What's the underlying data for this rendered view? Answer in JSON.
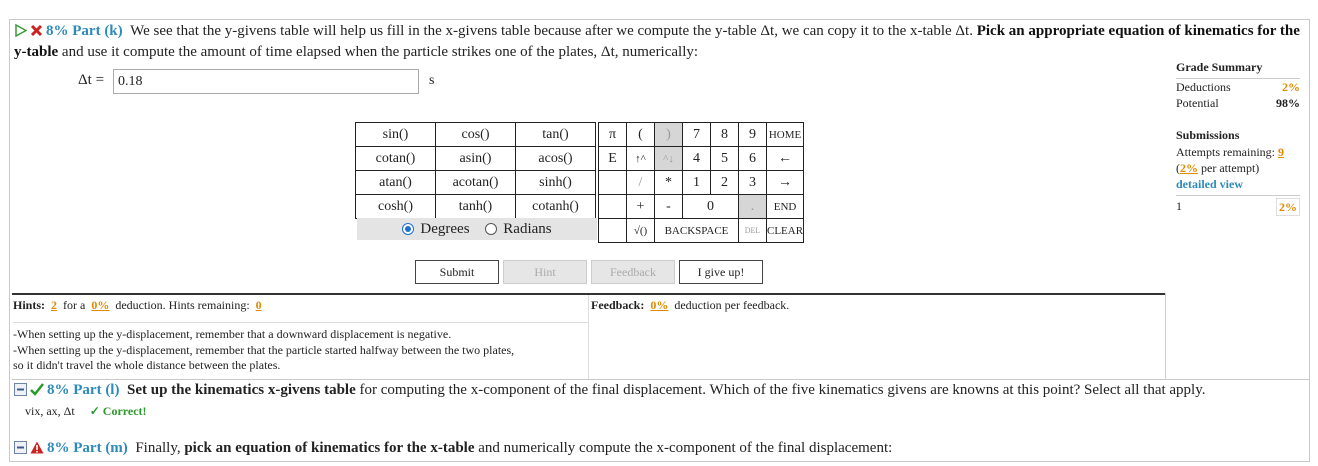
{
  "part_k": {
    "percent": "8% Part (k)",
    "text_1": "We see that the y-givens table will help us fill in the x-givens table because after we compute the y-table Δt, we can copy it to the x-table Δt.",
    "bold_1": "Pick an appropriate equation of kinematics for the y-table",
    "text_2": "and use it compute the amount of time elapsed when the particle strikes one of the plates, Δt, numerically:",
    "answer_label": "Δt =",
    "answer_value": "0.18",
    "answer_unit": "s"
  },
  "grade_summary": {
    "title": "Grade Summary",
    "deductions_label": "Deductions",
    "deductions_value": "2%",
    "potential_label": "Potential",
    "potential_value": "98%"
  },
  "submissions": {
    "title": "Submissions",
    "attempts_label": "Attempts remaining:",
    "attempts_value": "9",
    "per_attempt_pct": "2%",
    "per_attempt_suffix": "per attempt)",
    "detailed_view": "detailed view",
    "attempt_number": "1",
    "attempt_pct": "2%"
  },
  "calculator": {
    "functions": [
      [
        "sin()",
        "cos()",
        "tan()"
      ],
      [
        "cotan()",
        "asin()",
        "acos()"
      ],
      [
        "atan()",
        "acotan()",
        "sinh()"
      ],
      [
        "cosh()",
        "tanh()",
        "cotanh()"
      ]
    ],
    "angle_mode": {
      "degrees": "Degrees",
      "radians": "Radians",
      "selected": "Degrees"
    },
    "keys": {
      "pi": "π",
      "lparen": "(",
      "rparen": ")",
      "n7": "7",
      "n8": "8",
      "n9": "9",
      "home": "HOME",
      "e": "E",
      "up": "↑^",
      "up2": "^↓",
      "n4": "4",
      "n5": "5",
      "n6": "6",
      "left": "←",
      "div": "/",
      "mul": "*",
      "n1": "1",
      "n2": "2",
      "n3": "3",
      "right": "→",
      "plus": "+",
      "minus": "-",
      "n0": "0",
      "dot": ".",
      "end": "END",
      "sqrt": "√()",
      "backspace": "BACKSPACE",
      "del": "DEL",
      "clear": "CLEAR"
    }
  },
  "actions": {
    "submit": "Submit",
    "hint": "Hint",
    "feedback": "Feedback",
    "give_up": "I give up!"
  },
  "hints": {
    "label": "Hints:",
    "count": "2",
    "for_a": "for a",
    "deduction_pct": "0%",
    "deduction_text": "deduction. Hints remaining:",
    "remaining": "0",
    "items": [
      "-When setting up the y-displacement, remember that a downward displacement is negative.",
      "-When setting up the y-displacement, remember that the particle started halfway between the two plates,",
      "so it didn't travel the whole distance between the plates."
    ]
  },
  "feedback": {
    "label": "Feedback:",
    "pct": "0%",
    "text": "deduction per feedback."
  },
  "part_l": {
    "percent": "8% Part (l)",
    "bold": "Set up the kinematics x-givens table",
    "text": "for computing the x-component of the final displacement. Which of the five kinematics givens are knowns at this point? Select all that apply.",
    "answer": "vix, ax, Δt",
    "status": "✓ Correct!"
  },
  "part_m": {
    "percent": "8% Part (m)",
    "text_1": "Finally,",
    "bold": "pick an equation of kinematics for the x-table",
    "text_2": "and numerically compute the x-component of the final displacement:"
  },
  "colors": {
    "accent_blue": "#2e8bb8",
    "orange": "#e08a00",
    "green": "#2a9a2a",
    "red": "#cc2222"
  }
}
